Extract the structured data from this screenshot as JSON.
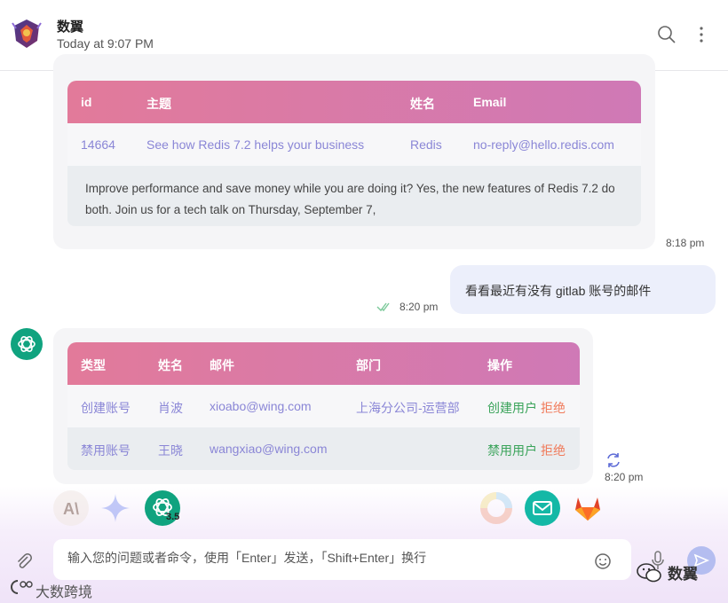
{
  "header": {
    "title": "数翼",
    "subtitle": "Today at 9:07 PM"
  },
  "email_card": {
    "headers": [
      "id",
      "主题",
      "姓名",
      "Email"
    ],
    "row": {
      "id": "14664",
      "subject": "See how Redis 7.2 helps your business",
      "name": "Redis",
      "email": "no-reply@hello.redis.com"
    },
    "body": "Improve performance and save money while you are doing it? Yes, the new features of Redis 7.2 do both. Join us for a tech talk on Thursday, September 7,",
    "time": "8:18 pm"
  },
  "user_message": {
    "text": "看看最近有没有 gitlab 账号的邮件",
    "time": "8:20 pm"
  },
  "account_card": {
    "headers": [
      "类型",
      "姓名",
      "邮件",
      "部门",
      "操作"
    ],
    "rows": [
      {
        "type": "创建账号",
        "name": "肖波",
        "email": "xioabo@wing.com",
        "dept": "上海分公司-运营部",
        "action_ok": "创建用户",
        "action_reject": "拒绝"
      },
      {
        "type": "禁用账号",
        "name": "王晓",
        "email": "wangxiao@wing.com",
        "dept": "",
        "action_ok": "禁用用户",
        "action_reject": "拒绝"
      }
    ],
    "time": "8:20 pm"
  },
  "models": {
    "gpt_badge": "3.5"
  },
  "composer": {
    "placeholder": "输入您的问题或者命令，使用「Enter」发送，「Shift+Enter」换行"
  },
  "watermarks": {
    "left": "大数跨境",
    "right": "数翼"
  },
  "colors": {
    "accent_gradient_start": "#e27a9a",
    "accent_gradient_end": "#cf79b6",
    "link_purple": "#8a86d6",
    "action_green": "#3aa35a",
    "action_red": "#f07a5a",
    "gpt_green": "#10a37f"
  }
}
